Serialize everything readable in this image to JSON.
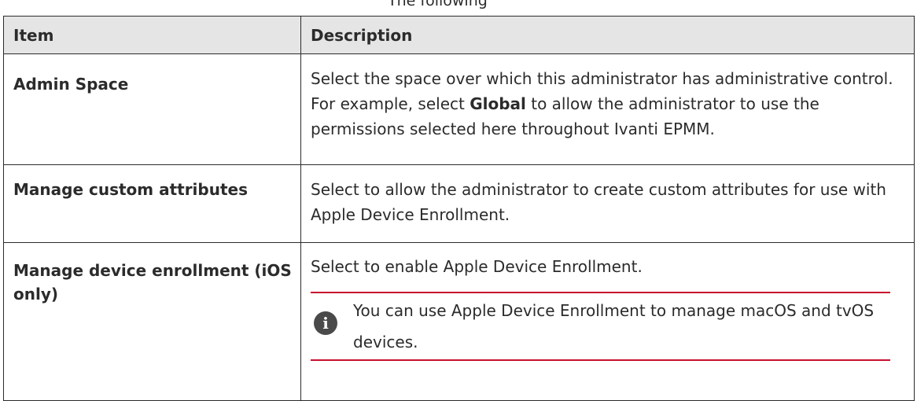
{
  "clipped_caption": "The following",
  "table": {
    "headers": {
      "item": "Item",
      "description": "Description"
    },
    "rows": [
      {
        "item": "Admin Space",
        "desc_part1": "Select the space over which this administrator has administrative control. For example, select ",
        "desc_bold": "Global",
        "desc_part2": " to allow the administrator to use the permissions selected here throughout Ivanti EPMM."
      },
      {
        "item": "Manage custom attributes",
        "description": "Select to allow the administrator to create custom attributes for use with Apple Device Enrollment."
      },
      {
        "item": "Manage device enrollment (iOS only)",
        "description": "Select to enable Apple Device Enrollment.",
        "note": {
          "icon": "info-icon",
          "icon_glyph": "i",
          "text": "You can use Apple Device Enrollment to manage macOS and tvOS devices."
        }
      }
    ]
  },
  "colors": {
    "header_bg": "#e5e5e5",
    "note_rule": "#c8102e",
    "icon_bg": "#4a4a4a"
  }
}
